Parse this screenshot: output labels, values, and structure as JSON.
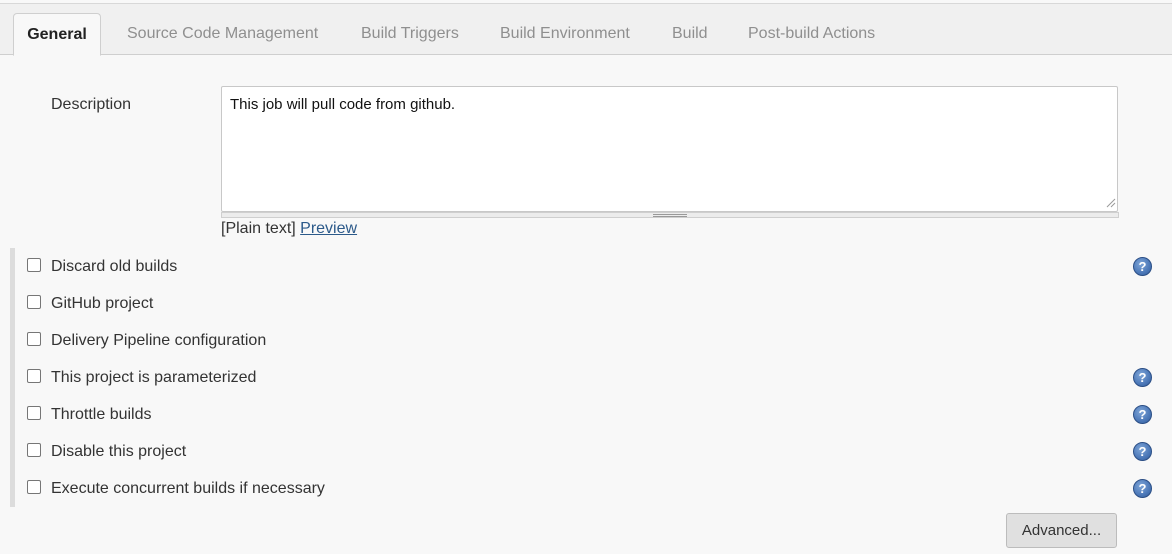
{
  "tabs": [
    {
      "label": "General",
      "active": true
    },
    {
      "label": "Source Code Management"
    },
    {
      "label": "Build Triggers"
    },
    {
      "label": "Build Environment"
    },
    {
      "label": "Build"
    },
    {
      "label": "Post-build Actions"
    }
  ],
  "description": {
    "label": "Description",
    "value": "This job will pull code from github.",
    "format_text": "[Plain text]",
    "preview_link": "Preview"
  },
  "options": [
    {
      "label": "Discard old builds",
      "checked": false,
      "help": true
    },
    {
      "label": "GitHub project",
      "checked": false,
      "help": false
    },
    {
      "label": "Delivery Pipeline configuration",
      "checked": false,
      "help": false
    },
    {
      "label": "This project is parameterized",
      "checked": false,
      "help": true
    },
    {
      "label": "Throttle builds",
      "checked": false,
      "help": true
    },
    {
      "label": "Disable this project",
      "checked": false,
      "help": true
    },
    {
      "label": "Execute concurrent builds if necessary",
      "checked": false,
      "help": true
    }
  ],
  "help_icon_text": "?",
  "advanced_button": "Advanced...",
  "colors": {
    "accent_link": "#2c5a8a",
    "help_icon": "#4c78b8"
  }
}
